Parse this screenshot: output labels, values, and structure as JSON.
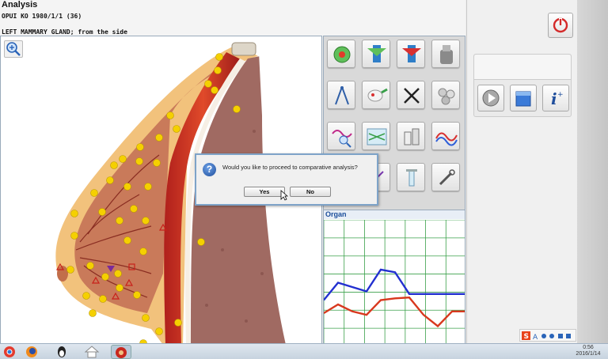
{
  "header": {
    "title": "Analysis",
    "patient": "OPUI KO   1980/1/1 (36)",
    "view_label": "LEFT MAMMARY GLAND; from the side"
  },
  "image_panel": {
    "zoom_icon": "magnifier-plus-icon"
  },
  "tools": [
    {
      "name": "target-icon"
    },
    {
      "name": "down-arrow-icon"
    },
    {
      "name": "red-down-arrow-icon"
    },
    {
      "name": "grinder-icon"
    },
    {
      "name": "compass-icon"
    },
    {
      "name": "dropper-icon"
    },
    {
      "name": "close-x-icon"
    },
    {
      "name": "molecules-icon"
    },
    {
      "name": "wave-magnifier-icon"
    },
    {
      "name": "lines-screen-icon"
    },
    {
      "name": "bottles-icon"
    },
    {
      "name": "spectrum-icon"
    },
    {
      "name": "probe-icon"
    },
    {
      "name": "syringe-icon"
    },
    {
      "name": "tube-icon"
    },
    {
      "name": "tool-icon"
    }
  ],
  "organ_chart": {
    "title": "Organ",
    "chart_data": {
      "type": "line",
      "x": [
        0,
        1,
        2,
        3,
        4,
        5,
        6,
        7,
        8,
        9,
        10
      ],
      "series": [
        {
          "color": "#2230d0",
          "values": [
            0.35,
            0.55,
            0.5,
            0.45,
            0.7,
            0.67,
            0.42,
            0.42,
            0.42,
            0.42,
            0.42
          ]
        },
        {
          "color": "#d8381e",
          "values": [
            0.2,
            0.3,
            0.22,
            0.18,
            0.35,
            0.37,
            0.38,
            0.18,
            0.05,
            0.22,
            0.22
          ]
        }
      ],
      "grid": true
    }
  },
  "right_panel": {
    "power_icon": "power-icon",
    "buttons": [
      "play-icon",
      "database-icon",
      "info-icon"
    ]
  },
  "dialog": {
    "message": "Would you like to proceed to comparative analysis?",
    "yes_label": "Yes",
    "no_label": "No",
    "icon": "question-icon"
  },
  "taskbar": {
    "time": "0:56",
    "date": "2016/1/14"
  },
  "colors": {
    "accent": "#1b4e9b",
    "marker": "#f5d000"
  }
}
